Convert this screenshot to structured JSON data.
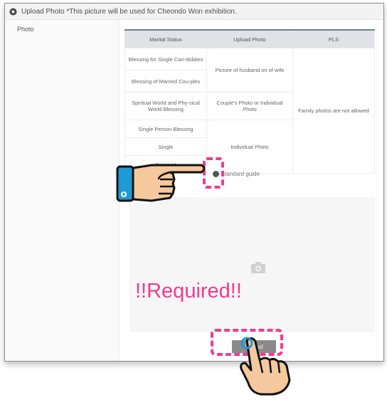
{
  "header": {
    "title": "Upload Photo *This picture will be used for Cheondo Won exhibition.",
    "icon": "gear-icon"
  },
  "sidebar": {
    "label": "Photo"
  },
  "table": {
    "columns": [
      "Marital Status",
      "Upload Photo",
      "PLS"
    ],
    "rows": [
      [
        "Blessing for Single Can-didates",
        "Picture of husband on of wife"
      ],
      [
        "Blessing of Married Cou-ples"
      ],
      [
        "Spiritual World and Phy-sical World Blessing",
        "Couple's Photo or Individual Photo",
        "Family photos are not allowed"
      ],
      [
        "Single Person Blessing"
      ],
      [
        "Single",
        "Individual Photo"
      ],
      [
        "Divorced"
      ]
    ]
  },
  "guide": {
    "label": "standard guide"
  },
  "upload": {
    "camera_icon": "camera-icon"
  },
  "annotation": {
    "required_text": "!!Required!!",
    "accent": "#ef3c8d"
  },
  "button": {
    "label": "Upload"
  }
}
